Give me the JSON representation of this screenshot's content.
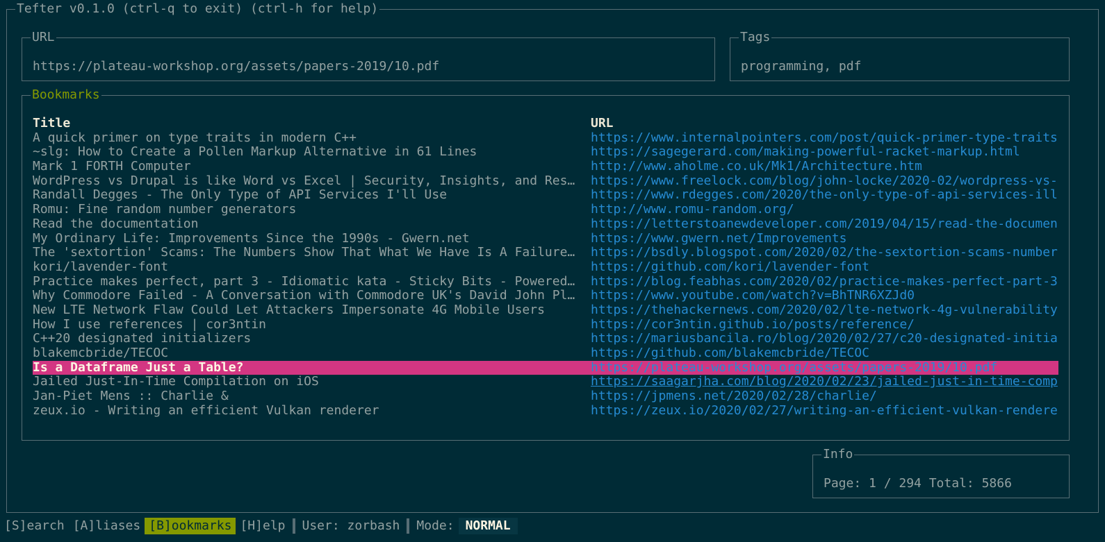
{
  "app": {
    "title": "Tefter v0.1.0 (ctrl-q to exit) (ctrl-h for help)"
  },
  "url_panel": {
    "label": "URL",
    "value": "https://plateau-workshop.org/assets/papers-2019/10.pdf"
  },
  "tags_panel": {
    "label": "Tags",
    "value": "programming, pdf"
  },
  "bookmarks": {
    "label": "Bookmarks",
    "columns": {
      "title": "Title",
      "url": "URL"
    },
    "selected_index": 16,
    "rows": [
      {
        "title": "A quick primer on type traits in modern C++",
        "url": "https://www.internalpointers.com/post/quick-primer-type-traits"
      },
      {
        "title": "~slg: How to Create a Pollen Markup Alternative in 61 Lines",
        "url": "https://sagegerard.com/making-powerful-racket-markup.html"
      },
      {
        "title": "Mark 1 FORTH Computer",
        "url": "http://www.aholme.co.uk/Mk1/Architecture.htm"
      },
      {
        "title": "WordPress vs Drupal is like Word vs Excel | Security, Insights, and Res…",
        "url": "https://www.freelock.com/blog/john-locke/2020-02/wordpress-vs-"
      },
      {
        "title": "Randall Degges - The Only Type of API Services I'll Use",
        "url": "https://www.rdegges.com/2020/the-only-type-of-api-services-ill"
      },
      {
        "title": "Romu: Fine random number generators",
        "url": "http://www.romu-random.org/"
      },
      {
        "title": "Read the documentation",
        "url": "https://letterstoanewdeveloper.com/2019/04/15/read-the-documen"
      },
      {
        "title": "My Ordinary Life: Improvements Since the 1990s - Gwern.net",
        "url": "https://www.gwern.net/Improvements"
      },
      {
        "title": "The 'sextortion' Scams: The Numbers Show That What We Have Is A Failure…",
        "url": "https://bsdly.blogspot.com/2020/02/the-sextortion-scams-number"
      },
      {
        "title": "kori/lavender-font",
        "url": "https://github.com/kori/lavender-font"
      },
      {
        "title": "Practice makes perfect, part 3 - Idiomatic kata - Sticky Bits - Powered…",
        "url": "https://blog.feabhas.com/2020/02/practice-makes-perfect-part-3"
      },
      {
        "title": "Why Commodore Failed - A Conversation with Commodore UK's David John Pl…",
        "url": "https://www.youtube.com/watch?v=BhTNR6XZJd0"
      },
      {
        "title": "New LTE Network Flaw Could Let Attackers Impersonate 4G Mobile Users",
        "url": "https://thehackernews.com/2020/02/lte-network-4g-vulnerability"
      },
      {
        "title": "How I use references | cor3ntin",
        "url": "https://cor3ntin.github.io/posts/reference/"
      },
      {
        "title": "C++20 designated initializers",
        "url": "https://mariusbancila.ro/blog/2020/02/27/c20-designated-initia"
      },
      {
        "title": "blakemcbride/TECOC",
        "url": "https://github.com/blakemcbride/TECOC"
      },
      {
        "title": "Is a Dataframe Just a Table?",
        "url": "https://plateau-workshop.org/assets/papers-2019/10.pdf"
      },
      {
        "title": "Jailed Just-In-Time Compilation on iOS",
        "url": "https://saagarjha.com/blog/2020/02/23/jailed-just-in-time-comp"
      },
      {
        "title": "Jan-Piet Mens :: Charlie &",
        "url": "https://jpmens.net/2020/02/28/charlie/"
      },
      {
        "title": "zeux.io - Writing an efficient Vulkan renderer",
        "url": "https://zeux.io/2020/02/27/writing-an-efficient-vulkan-rendere"
      }
    ]
  },
  "info_panel": {
    "label": "Info",
    "text": "Page: 1 / 294 Total: 5866"
  },
  "statusbar": {
    "search": "[S]earch",
    "aliases": "[A]liases",
    "bookmarks": "[B]ookmarks",
    "help": "[H]elp",
    "user": "User: zorbash",
    "mode_label": "Mode:",
    "mode_value": "NORMAL"
  },
  "colors": {
    "background": "#002b36",
    "border": "#586e75",
    "text": "#93a1a1",
    "link": "#268bd2",
    "selection": "#d33682",
    "accent": "#859900"
  }
}
